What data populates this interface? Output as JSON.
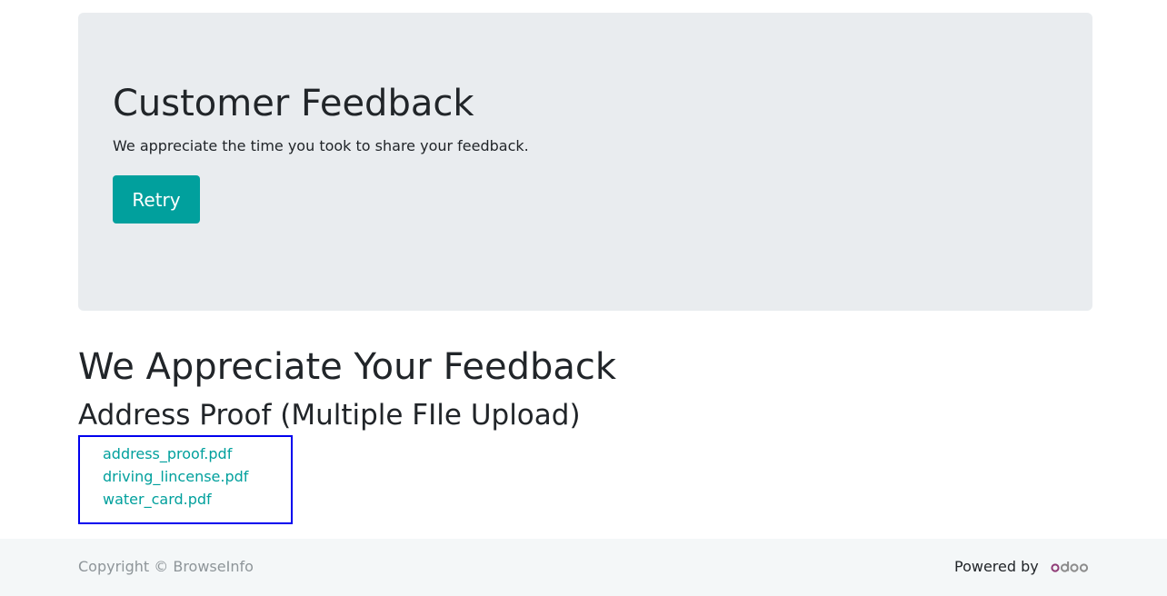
{
  "feedback": {
    "title": "Customer Feedback",
    "subtitle": "We appreciate the time you took to share your feedback.",
    "retry_label": "Retry"
  },
  "main": {
    "heading": "We Appreciate Your Feedback",
    "subheading": "Address Proof (Multiple FIle Upload)",
    "files": [
      "address_proof.pdf",
      "driving_lincense.pdf",
      "water_card.pdf"
    ]
  },
  "footer": {
    "copyright": "Copyright © BrowseInfo",
    "powered_by": "Powered by",
    "logo_text": "odoo"
  },
  "colors": {
    "accent": "#01a09d",
    "highlight_border": "#0000ee",
    "jumbotron_bg": "#e9ecef",
    "footer_bg": "#f4f7f8"
  }
}
